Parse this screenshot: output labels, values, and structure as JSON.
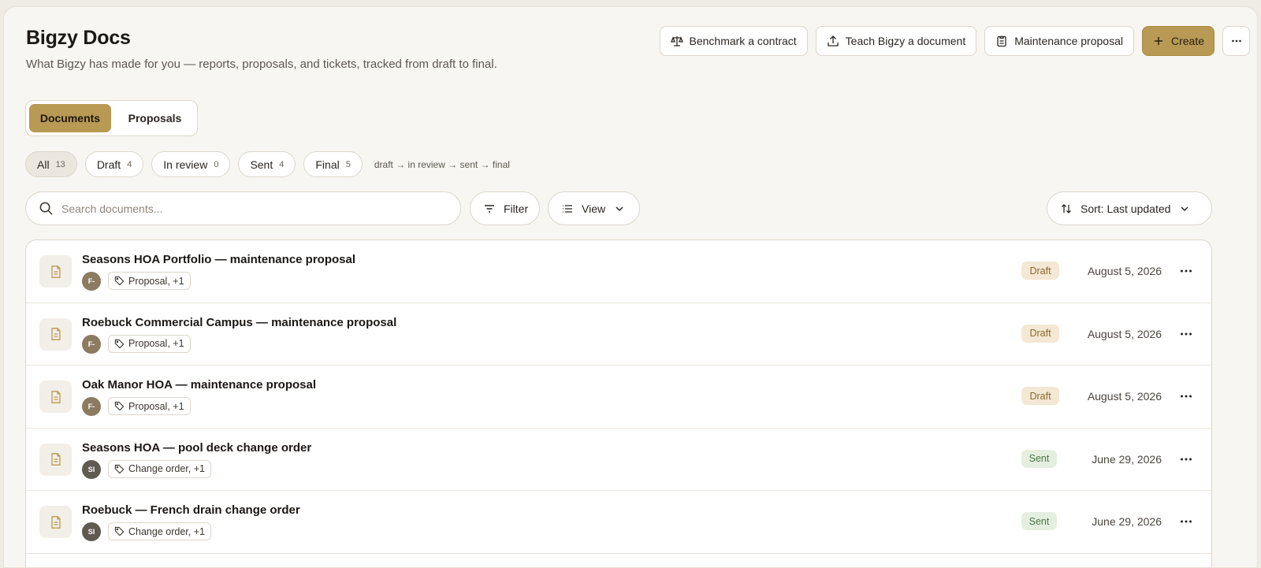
{
  "header": {
    "title": "Bigzy Docs",
    "subtitle": "What Bigzy has made for you — reports, proposals, and tickets, tracked from draft to final."
  },
  "actions": {
    "benchmark_label": "Benchmark a contract",
    "teach_label": "Teach Bigzy a document",
    "maintenance_label": "Maintenance proposal",
    "create_label": "Create"
  },
  "tabs": [
    {
      "label": "Documents",
      "active": true
    },
    {
      "label": "Proposals",
      "active": false
    }
  ],
  "filters": [
    {
      "label": "All",
      "count": "13",
      "active": true
    },
    {
      "label": "Draft",
      "count": "4",
      "active": false
    },
    {
      "label": "In review",
      "count": "0",
      "active": false
    },
    {
      "label": "Sent",
      "count": "4",
      "active": false
    },
    {
      "label": "Final",
      "count": "5",
      "active": false
    }
  ],
  "flow_note": "draft → in review → sent → final",
  "search": {
    "placeholder": "Search documents..."
  },
  "toolbar": {
    "filter_label": "Filter",
    "view_label": "View",
    "sort_label": "Sort: Last updated"
  },
  "documents": [
    {
      "title": "Seasons HOA Portfolio — maintenance proposal",
      "initials": "F-",
      "tag": "Proposal, +1",
      "status": "Draft",
      "date": "August 5, 2026"
    },
    {
      "title": "Roebuck Commercial Campus — maintenance proposal",
      "initials": "F-",
      "tag": "Proposal, +1",
      "status": "Draft",
      "date": "August 5, 2026"
    },
    {
      "title": "Oak Manor HOA — maintenance proposal",
      "initials": "F-",
      "tag": "Proposal, +1",
      "status": "Draft",
      "date": "August 5, 2026"
    },
    {
      "title": "Seasons HOA — pool deck change order",
      "initials": "SI",
      "tag": "Change order, +1",
      "status": "Sent",
      "date": "June 29, 2026"
    },
    {
      "title": "Roebuck — French drain change order",
      "initials": "SI",
      "tag": "Change order, +1",
      "status": "Sent",
      "date": "June 29, 2026"
    }
  ],
  "colors": {
    "accent": "#b89a55",
    "draft_bg": "#f4e7d3",
    "draft_text": "#8a6a31",
    "sent_bg": "#e5efe0",
    "sent_text": "#4b7449"
  }
}
